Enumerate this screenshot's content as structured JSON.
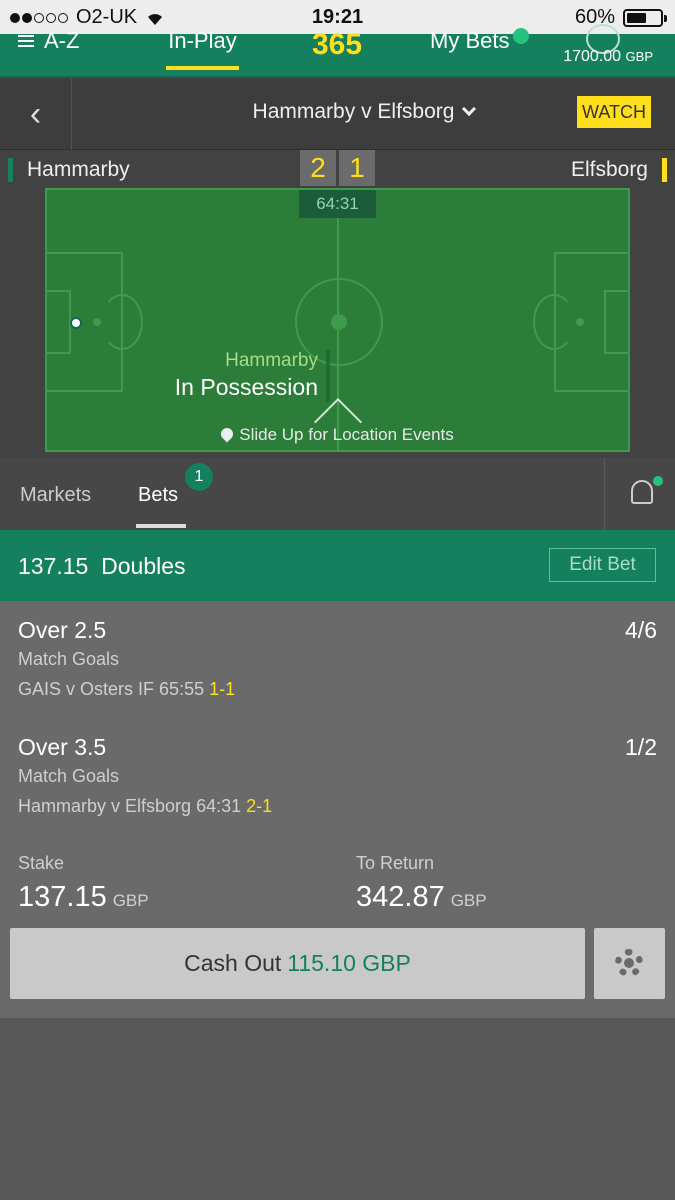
{
  "status_bar": {
    "carrier": "O2-UK",
    "time": "19:21",
    "battery": "60%",
    "battery_level": 0.6
  },
  "nav": {
    "az": "A-Z",
    "inplay": "In-Play",
    "logo": "bet365",
    "mybets": "My Bets",
    "balance": "1700.00",
    "balance_currency": "GBP"
  },
  "match": {
    "title": "Hammarby v Elfsborg",
    "watch": "WATCH"
  },
  "scoreboard": {
    "home_team": "Hammarby",
    "away_team": "Elfsborg",
    "home_score": "2",
    "away_score": "1",
    "clock": "64:31"
  },
  "pitch": {
    "possession_team": "Hammarby",
    "possession_label": "In Possession",
    "slide_up": "Slide Up for Location Events"
  },
  "tabs": {
    "markets": "Markets",
    "bets": "Bets",
    "bets_badge": "1"
  },
  "bet": {
    "title": "137.15  Doubles",
    "edit": "Edit Bet",
    "selections": [
      {
        "name": "Over 2.5",
        "odds": "4/6",
        "market": "Match Goals",
        "event": "GAIS v Osters IF",
        "time": "65:55",
        "score": "1-1"
      },
      {
        "name": "Over 3.5",
        "odds": "1/2",
        "market": "Match Goals",
        "event": "Hammarby v Elfsborg",
        "time": "64:31",
        "score": "2-1"
      }
    ],
    "stake_label": "Stake",
    "stake": "137.15",
    "stake_currency": "GBP",
    "return_label": "To Return",
    "return": "342.87",
    "return_currency": "GBP",
    "cashout_label": "Cash Out",
    "cashout_amount": "115.10 GBP"
  },
  "colors": {
    "brand_green": "#14805e",
    "accent_yellow": "#ffdf1b",
    "pitch_green": "#2c7d3a"
  }
}
